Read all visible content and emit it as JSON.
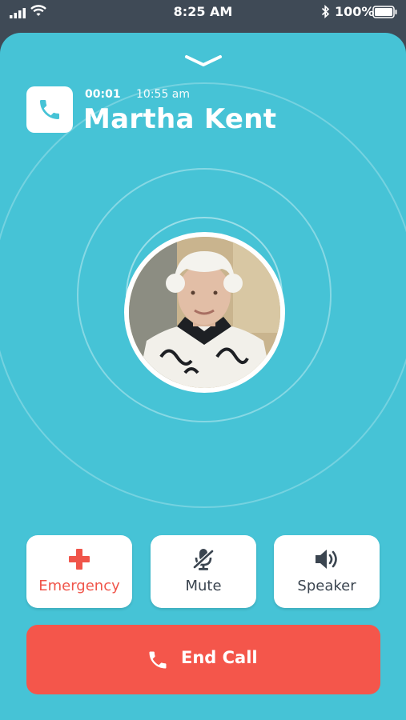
{
  "status_bar": {
    "time": "8:25 AM",
    "battery": "100%",
    "icons": [
      "signal-icon",
      "wifi-icon",
      "bluetooth-icon",
      "battery-icon"
    ]
  },
  "call": {
    "duration": "00:01",
    "start_time": "10:55 am",
    "caller_name": "Martha Kent",
    "collapse_icon": "chevron-down-icon",
    "call_icon": "phone-icon"
  },
  "actions": {
    "emergency": {
      "label": "Emergency",
      "icon": "plus-icon"
    },
    "mute": {
      "label": "Mute",
      "icon": "microphone-off-icon"
    },
    "speaker": {
      "label": "Speaker",
      "icon": "speaker-icon"
    }
  },
  "end_call": {
    "label": "End Call",
    "icon": "phone-hangup-icon"
  },
  "colors": {
    "background": "#46c3d6",
    "status_bar": "#3f4a56",
    "emergency": "#f0554a",
    "end_call": "#f4564b",
    "button_text": "#3b4550"
  }
}
